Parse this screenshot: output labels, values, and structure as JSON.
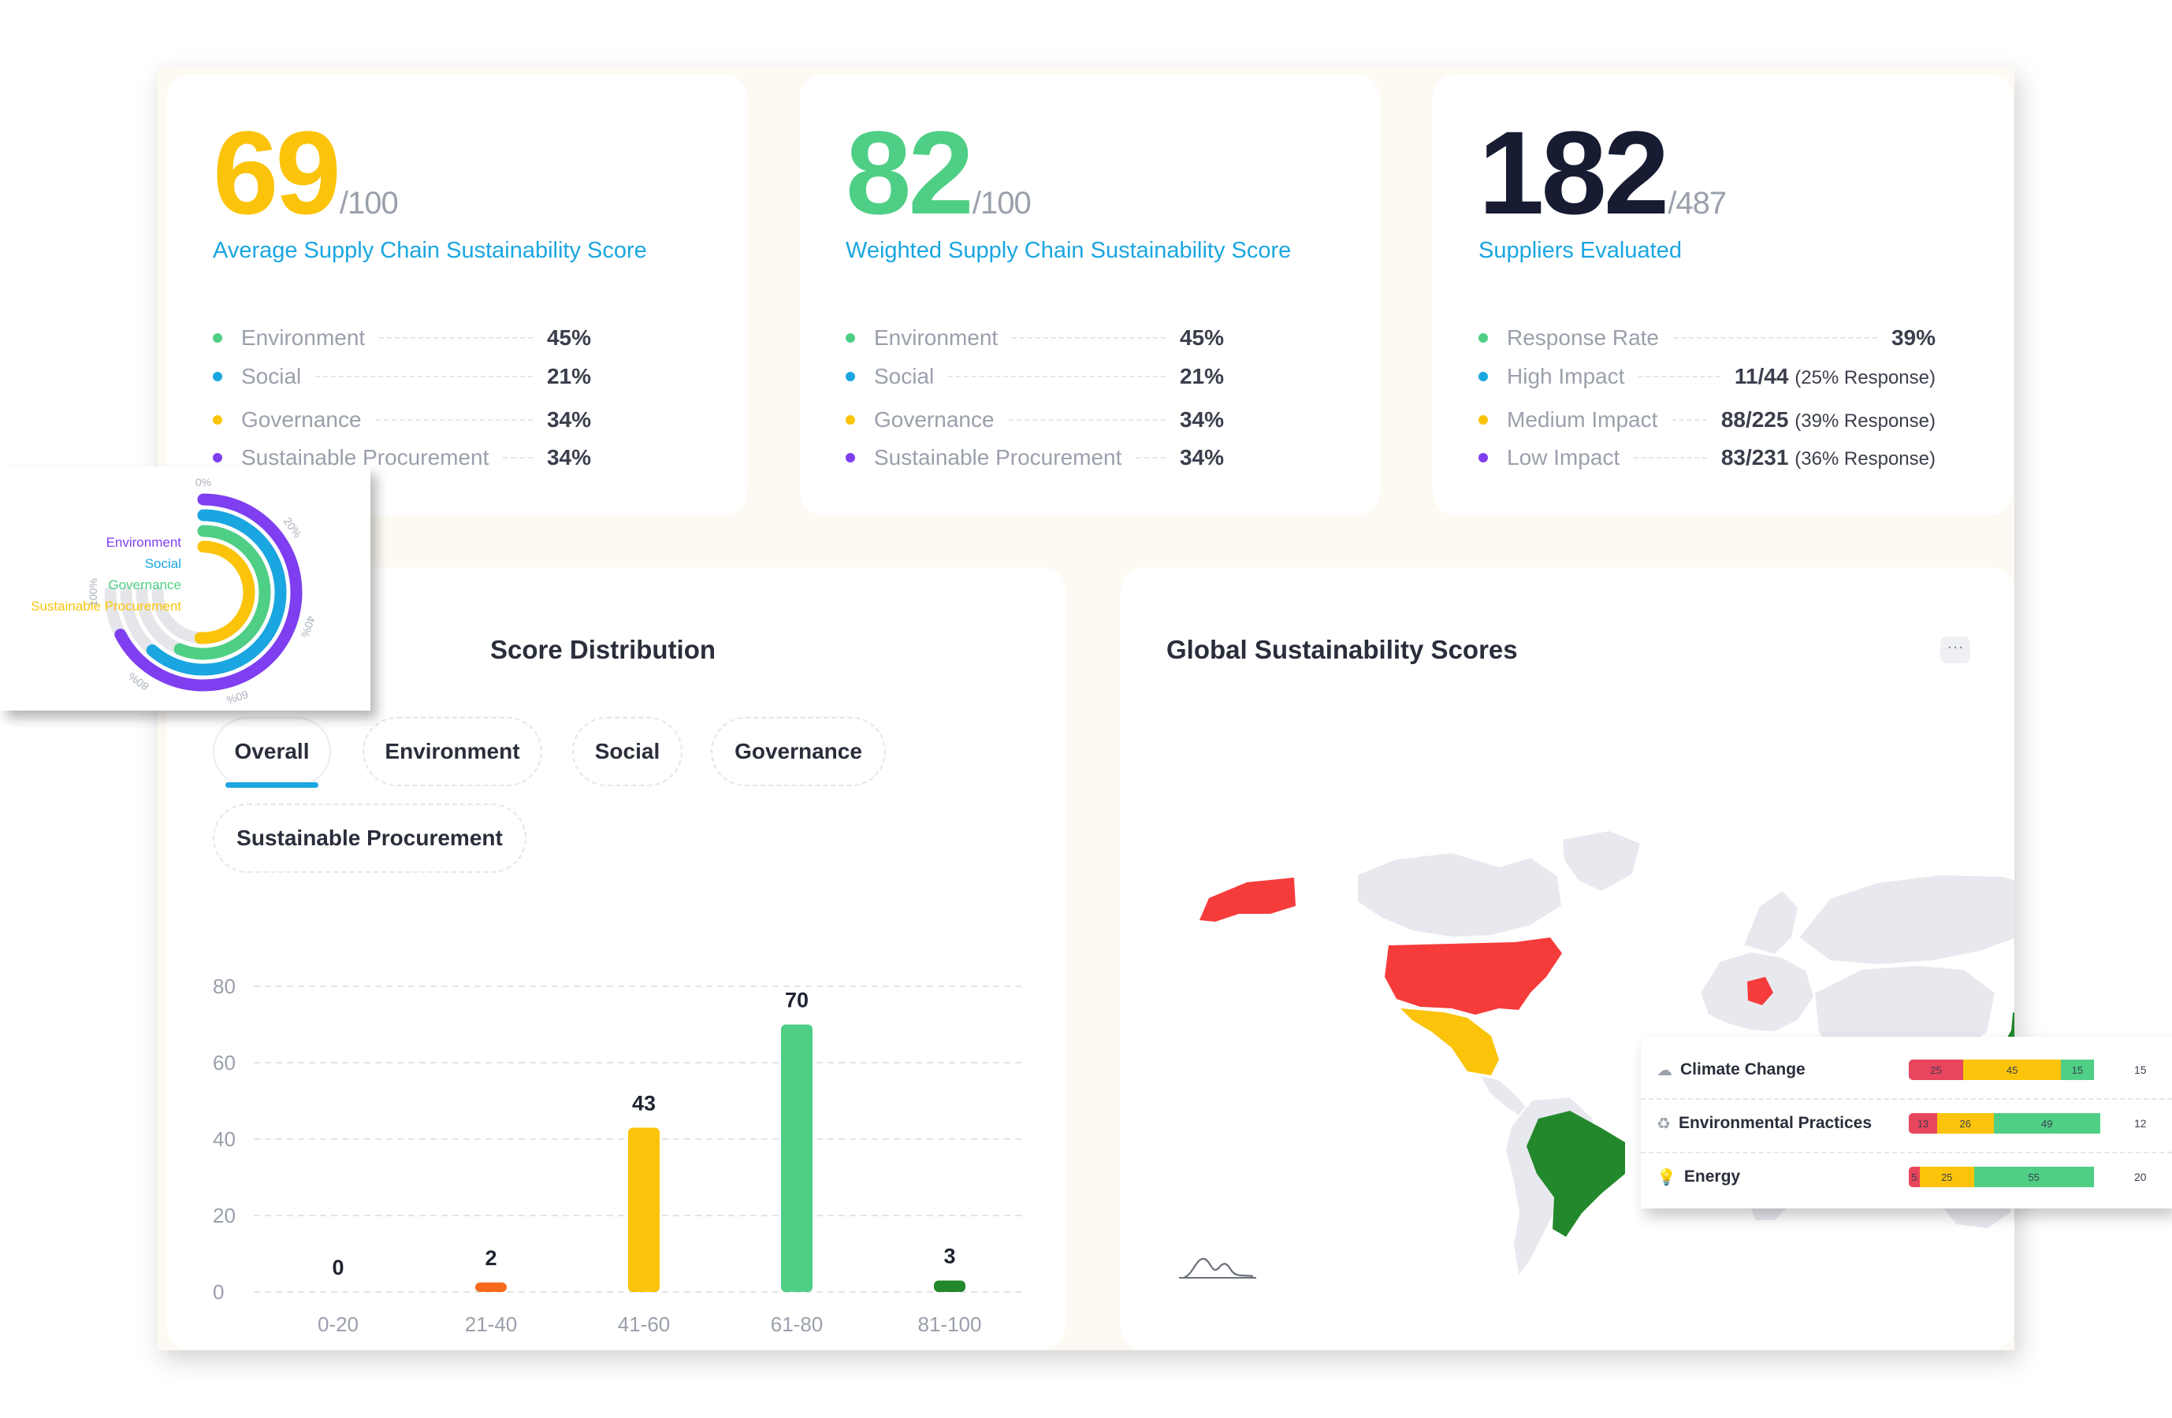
{
  "colors": {
    "yellow": "#fbc40a",
    "green": "#4fcf86",
    "navy": "#171c33",
    "blue": "#1aa6e0",
    "purple": "#7f3ff0",
    "red": "#e8455e",
    "orange": "#f76b1c",
    "dark_green": "#23882b"
  },
  "score_cards": [
    {
      "value": "69",
      "denominator": "/100",
      "subtitle": "Average Supply Chain Sustainability Score",
      "metrics": [
        {
          "label": "Environment",
          "value": "45%",
          "dot_color": "#4fcf86"
        },
        {
          "label": "Social",
          "value": "21%",
          "dot_color": "#1aa6e0"
        },
        {
          "label": "Governance",
          "value": "34%",
          "dot_color": "#fbc40a"
        },
        {
          "label": "Sustainable Procurement",
          "value": "34%",
          "dot_color": "#7f3ff0"
        }
      ]
    },
    {
      "value": "82",
      "denominator": "/100",
      "subtitle": "Weighted Supply Chain Sustainability Score",
      "metrics": [
        {
          "label": "Environment",
          "value": "45%",
          "dot_color": "#4fcf86"
        },
        {
          "label": "Social",
          "value": "21%",
          "dot_color": "#1aa6e0"
        },
        {
          "label": "Governance",
          "value": "34%",
          "dot_color": "#fbc40a"
        },
        {
          "label": "Sustainable Procurement",
          "value": "34%",
          "dot_color": "#7f3ff0"
        }
      ]
    },
    {
      "value": "182",
      "denominator": "/487",
      "subtitle": "Suppliers Evaluated",
      "metrics": [
        {
          "label": "Response Rate",
          "value": "39%",
          "note": "",
          "dot_color": "#4fcf86"
        },
        {
          "label": "High Impact",
          "value": "11/44",
          "note": "(25% Response)",
          "dot_color": "#1aa6e0"
        },
        {
          "label": "Medium Impact",
          "value": "88/225",
          "note": "(39% Response)",
          "dot_color": "#fbc40a"
        },
        {
          "label": "Low Impact",
          "value": "83/231",
          "note": "(36% Response)",
          "dot_color": "#7f3ff0"
        }
      ]
    }
  ],
  "distribution": {
    "title": "Score Distribution",
    "tabs": [
      "Overall",
      "Environment",
      "Social",
      "Governance",
      "Sustainable Procurement"
    ],
    "active_tab": "Overall"
  },
  "chart_data": {
    "type": "bar",
    "categories": [
      "0-20",
      "21-40",
      "41-60",
      "61-80",
      "81-100"
    ],
    "values": [
      0,
      2,
      43,
      70,
      3
    ],
    "bar_colors": [
      "#4fcf86",
      "#f76b1c",
      "#fbc40a",
      "#4fcf86",
      "#23882b"
    ],
    "yticks": [
      0,
      20,
      40,
      60,
      80
    ],
    "ylim": [
      0,
      80
    ],
    "grid": true
  },
  "map": {
    "title": "Global Sustainability Scores",
    "more_label": "···"
  },
  "radial": {
    "labels": [
      "Environment",
      "Social",
      "Governance",
      "Sustainable Procurement"
    ],
    "values": [
      90,
      82,
      75,
      68
    ],
    "colors": [
      "#7f3ff0",
      "#1aa6e0",
      "#4fcf86",
      "#fbc40a"
    ],
    "ticks": [
      "0%",
      "20%",
      "40%",
      "60%",
      "80%",
      "100%"
    ]
  },
  "risk_breakdown": [
    {
      "label": "Climate Change",
      "icon": "cloud-icon",
      "segments": [
        25,
        45,
        15
      ],
      "remainder": "15"
    },
    {
      "label": "Environmental Practices",
      "icon": "recycle-icon",
      "segments": [
        13,
        26,
        49
      ],
      "remainder": "12"
    },
    {
      "label": "Energy",
      "icon": "bulb-icon",
      "segments": [
        5,
        25,
        55
      ],
      "remainder": "20"
    }
  ]
}
